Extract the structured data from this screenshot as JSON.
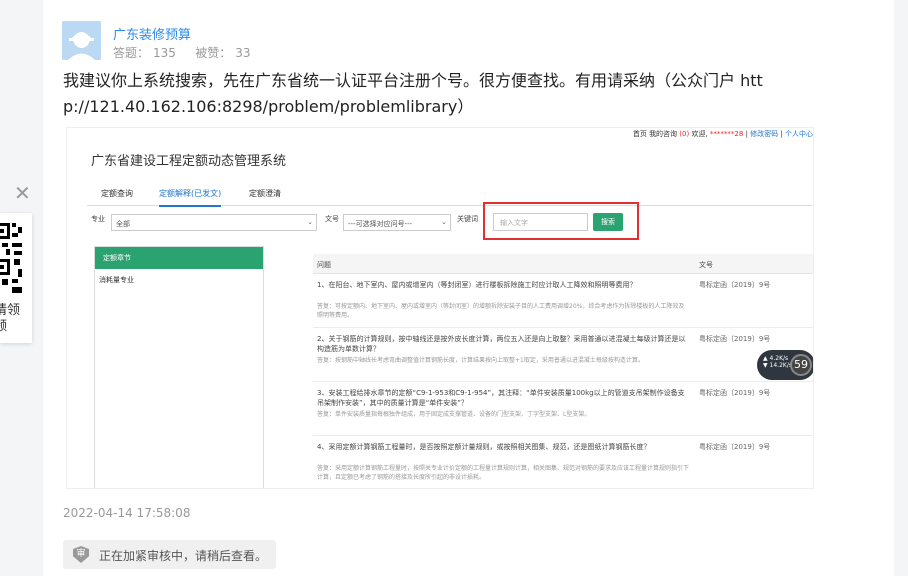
{
  "author": {
    "name": "广东装修预算",
    "answers_label": "答题：",
    "answers": "135",
    "likes_label": "被赞：",
    "likes": "33"
  },
  "answer_text": "我建议你上系统搜索，先在广东省统一认证平台注册个号。很方便查找。有用请采纳（公众门户  http://121.40.162.106:8298/problem/problemlibrary）",
  "screenshot": {
    "top_links": {
      "home": "首页",
      "my_consult": "我的咨询",
      "count": "(0)",
      "welcome": "欢迎,",
      "user": "*******28",
      "sep": "|",
      "change_pwd": "修改密码",
      "personal": "个人中心"
    },
    "system_title": "广东省建设工程定额动态管理系统",
    "tabs": [
      "定额查询",
      "定额解释(已发文)",
      "定额澄清"
    ],
    "filters": {
      "major_label": "专业",
      "major_value": "全部",
      "doc_label": "文号",
      "doc_value": "---可选择对应问号---",
      "keyword_label": "关键词",
      "keyword_placeholder": "输入文字",
      "search_button": "搜索"
    },
    "tree": {
      "header": "定额章节",
      "item": "消耗量专业"
    },
    "table": {
      "col_question": "问题",
      "col_doc": "文号",
      "rows": [
        {
          "q": "1、在阳台、地下室内、屋内或增室内（等封闭室）进行楼板拆除施工时应计取人工降效和照明等费用？",
          "a": "答复：可按定额内、地下室内、屋内或增室内（等封闭室）的增额拆除安装子目的人工费用调增20%，综合考虑作为拆除楼板的人工降效及照明等费用。",
          "doc": "粤标定函〔2019〕9号"
        },
        {
          "q": "2、关于钢筋的计算规则，按中轴线还是按外皮长度计算，两位五入还是向上取整？采用普通以进混凝土每级计算还是以构造筋为单数计算？",
          "a": "答复：按钢筋中轴线长考虑弯曲调整值计算钢筋长度，计算结果按向上取整+1取定，采用普通以进混凝土每级按构造计算。",
          "doc": "粤标定函〔2019〕9号"
        },
        {
          "q": "3、安装工程给排水章节的定额“C9-1-953和C9-1-954”，其注释：“单件安装质量100kg以上的管道支吊架制作设备支吊架制作安装”，其中的质量计算是“单件安装”？",
          "a": "答复：单件安装质量指每根独件组成，用于固定成支撑管道、设备的门型支架、丁字型支架、L型支架。",
          "doc": "粤标定函〔2019〕9号"
        },
        {
          "q": "4、采用定额计算钢筋工程量时，是否按照定额计量规则，或按照相关图集、规范，还是图纸计算钢筋长度？",
          "a": "答复：采用定额计算钢筋工程量时，按照关专业计价定额的工程量计算规则计算，相关图集、规范对钢筋的要求及应该工程量计算规则指引下计算，且定额已考虑了钢筋的搭接及长度所引起的非设计损耗。",
          "doc": "粤标定函〔2019〕9号"
        }
      ]
    },
    "speed_widget": {
      "up": "4.2",
      "down": "14.2",
      "unit": "K/s",
      "value": "59"
    }
  },
  "timestamp": "2022-04-14 17:58:08",
  "review_notice": "正在加紧审核中，请稍后查看。",
  "review_badge": "审",
  "side_widget": {
    "close": "✕",
    "text_line1": "请领",
    "text_line2": "频"
  }
}
